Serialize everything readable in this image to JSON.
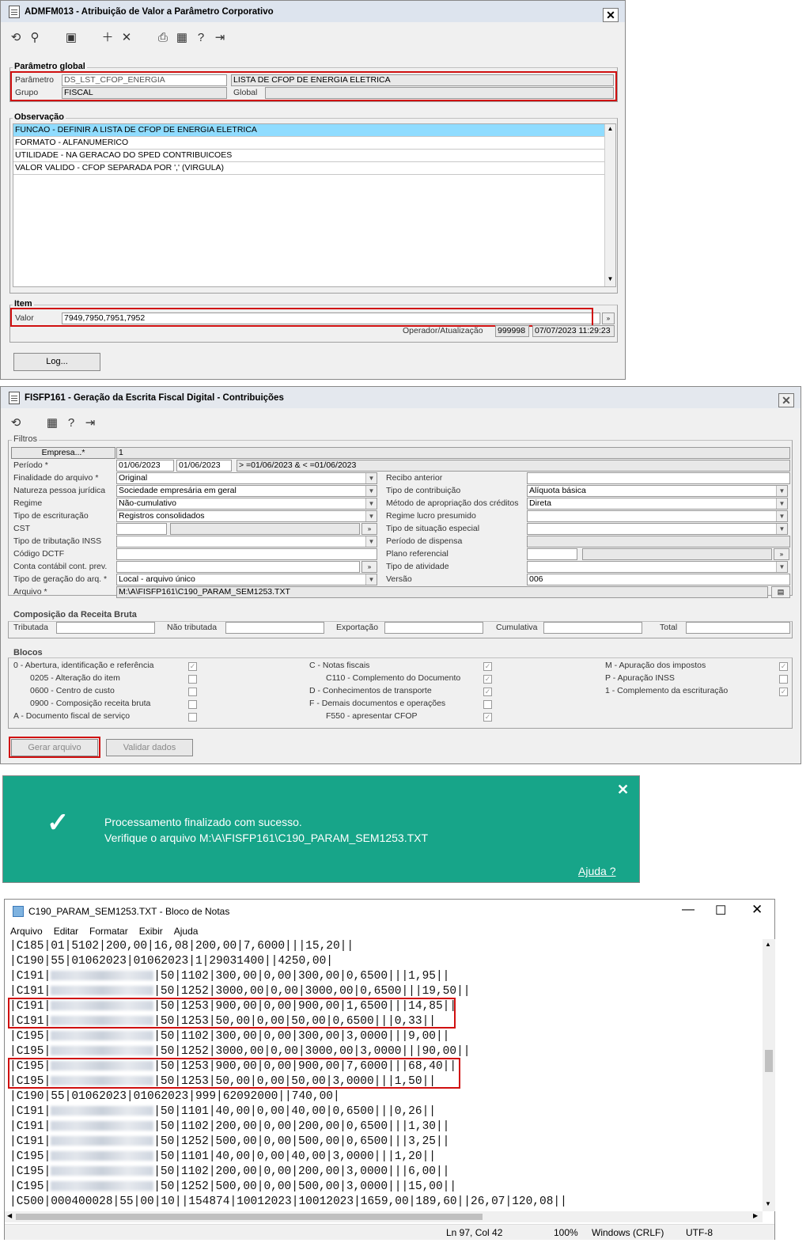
{
  "win1": {
    "title": "ADMFM013 - Atribuição de Valor a Parâmetro Corporativo",
    "close": "✕",
    "global_group": "Parâmetro global",
    "parametro_label": "Parâmetro",
    "parametro_value": "DS_LST_CFOP_ENERGIA",
    "parametro_desc": "LISTA DE CFOP DE ENERGIA ELETRICA",
    "grupo_label": "Grupo",
    "grupo_value": "FISCAL",
    "global_label": "Global",
    "obs_group": "Observação",
    "obs_lines": [
      "FUNCAO - DEFINIR A LISTA DE CFOP DE ENERGIA ELETRICA",
      "FORMATO - ALFANUMERICO",
      "UTILIDADE - NA GERACAO DO SPED CONTRIBUICOES",
      "VALOR VALIDO - CFOP SEPARADA POR ',' (VIRGULA)"
    ],
    "item_group": "Item",
    "valor_label": "Valor",
    "valor_value": "7949,7950,7951,7952",
    "operador_label": "Operador/Atualização",
    "operador_value": "999998",
    "atualizacao_value": "07/07/2023 11:29:23",
    "log_button": "Log..."
  },
  "win2": {
    "title": "FISFP161 - Geração da Escrita Fiscal Digital - Contribuições",
    "close": "✕",
    "filtros": "Filtros",
    "empresa_btn": "Empresa...*",
    "empresa_value": "1",
    "periodo_label": "Período *",
    "periodo_ini": "01/06/2023",
    "periodo_fim": "01/06/2023",
    "periodo_expr": "> =01/06/2023 & < =01/06/2023",
    "finalidade_label": "Finalidade do arquivo *",
    "finalidade_value": "Original",
    "recibo_label": "Recibo anterior",
    "natureza_label": "Natureza pessoa jurídica",
    "natureza_value": "Sociedade empresária em geral",
    "tipo_contrib_label": "Tipo de contribuição",
    "tipo_contrib_value": "Alíquota básica",
    "regime_label": "Regime",
    "regime_value": "Não-cumulativo",
    "metodo_label": "Método de apropriação dos créditos",
    "metodo_value": "Direta",
    "tipo_escrit_label": "Tipo de escrituração",
    "tipo_escrit_value": "Registros consolidados",
    "regime_lucro_label": "Regime lucro presumido",
    "cst_label": "CST",
    "tipo_situacao_label": "Tipo de situação especial",
    "tipo_trib_inss_label": "Tipo de tributação INSS",
    "periodo_dispensa_label": "Período de dispensa",
    "codigo_dctf_label": "Código DCTF",
    "plano_ref_label": "Plano referencial",
    "conta_contabil_label": "Conta contábil cont. prev.",
    "tipo_atividade_label": "Tipo de atividade",
    "tipo_geracao_label": "Tipo de geração do arq. *",
    "tipo_geracao_value": "Local - arquivo único",
    "versao_label": "Versão",
    "versao_value": "006",
    "arquivo_label": "Arquivo *",
    "arquivo_value": "M:\\A\\FISFP161\\C190_PARAM_SEM1253.TXT",
    "receita_group": "Composição da Receita Bruta",
    "tributada": "Tributada",
    "nao_tributada": "Não tributada",
    "exportacao": "Exportação",
    "cumulativa": "Cumulativa",
    "total": "Total",
    "blocos_group": "Blocos",
    "blocos_col1": [
      {
        "label": "0 - Abertura, identificação e referência",
        "checked": true
      },
      {
        "label": "0205 - Alteração do item",
        "checked": false
      },
      {
        "label": "0600 - Centro de custo",
        "checked": false
      },
      {
        "label": "0900 - Composição receita bruta",
        "checked": false
      },
      {
        "label": "A - Documento fiscal de serviço",
        "checked": false
      }
    ],
    "blocos_col2": [
      {
        "label": "C - Notas fiscais",
        "checked": true
      },
      {
        "label": "C110 - Complemento do Documento",
        "checked": true
      },
      {
        "label": "D - Conhecimentos de transporte",
        "checked": true
      },
      {
        "label": "F - Demais documentos e operações",
        "checked": false
      },
      {
        "label": "F550 - apresentar CFOP",
        "checked": true
      }
    ],
    "blocos_col3": [
      {
        "label": "M - Apuração dos impostos",
        "checked": true
      },
      {
        "label": "P - Apuração INSS",
        "checked": false
      },
      {
        "label": "1 - Complemento da escrituração",
        "checked": true
      }
    ],
    "gerar_btn": "Gerar arquivo",
    "validar_btn": "Validar dados"
  },
  "toast": {
    "line1": "Processamento finalizado com sucesso.",
    "line2": "Verifique o arquivo M:\\A\\FISFP161\\C190_PARAM_SEM1253.TXT",
    "help": "Ajuda ?",
    "close": "✕",
    "color": "#17a589"
  },
  "notepad": {
    "title": "C190_PARAM_SEM1253.TXT - Bloco de Notas",
    "menu": [
      "Arquivo",
      "Editar",
      "Formatar",
      "Exibir",
      "Ajuda"
    ],
    "lines": [
      {
        "pre": "|C185|01|5102|200,00|16,08|200,00|7,6000|||15,20||",
        "post": ""
      },
      {
        "pre": "|C190|55|01062023|01062023|1|29031400||4250,00|",
        "post": ""
      },
      {
        "pre": "|C191|",
        "blur": true,
        "post": "|50|1102|300,00|0,00|300,00|0,6500|||1,95||"
      },
      {
        "pre": "|C191|",
        "blur": true,
        "post": "|50|1252|3000,00|0,00|3000,00|0,6500|||19,50||"
      },
      {
        "pre": "|C191|",
        "blur": true,
        "post": "|50|1253|900,00|0,00|900,00|1,6500|||14,85||"
      },
      {
        "pre": "|C191|",
        "blur": true,
        "post": "|50|1253|50,00|0,00|50,00|0,6500|||0,33||"
      },
      {
        "pre": "|C195|",
        "blur": true,
        "post": "|50|1102|300,00|0,00|300,00|3,0000|||9,00||"
      },
      {
        "pre": "|C195|",
        "blur": true,
        "post": "|50|1252|3000,00|0,00|3000,00|3,0000|||90,00||"
      },
      {
        "pre": "|C195|",
        "blur": true,
        "post": "|50|1253|900,00|0,00|900,00|7,6000|||68,40||"
      },
      {
        "pre": "|C195|",
        "blur": true,
        "post": "|50|1253|50,00|0,00|50,00|3,0000|||1,50||"
      },
      {
        "pre": "|C190|55|01062023|01062023|999|62092000||740,00|",
        "post": ""
      },
      {
        "pre": "|C191|",
        "blur": true,
        "post": "|50|1101|40,00|0,00|40,00|0,6500|||0,26||"
      },
      {
        "pre": "|C191|",
        "blur": true,
        "post": "|50|1102|200,00|0,00|200,00|0,6500|||1,30||"
      },
      {
        "pre": "|C191|",
        "blur": true,
        "post": "|50|1252|500,00|0,00|500,00|0,6500|||3,25||"
      },
      {
        "pre": "|C195|",
        "blur": true,
        "post": "|50|1101|40,00|0,00|40,00|3,0000|||1,20||"
      },
      {
        "pre": "|C195|",
        "blur": true,
        "post": "|50|1102|200,00|0,00|200,00|3,0000|||6,00||"
      },
      {
        "pre": "|C195|",
        "blur": true,
        "post": "|50|1252|500,00|0,00|500,00|3,0000|||15,00||"
      },
      {
        "pre": "|C500|000400028|55|00|10||154874|10012023|10012023|1659,00|189,60||26,07|120,08||",
        "post": ""
      }
    ],
    "status_pos": "Ln 97, Col 42",
    "status_zoom": "100%",
    "status_eol": "Windows (CRLF)",
    "status_enc": "UTF-8"
  }
}
